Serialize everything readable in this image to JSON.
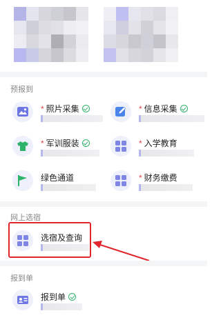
{
  "sections": {
    "pre_registration": {
      "title": "预报到",
      "items": [
        {
          "label": "照片采集",
          "required": true,
          "done": true,
          "icon": "photo-icon"
        },
        {
          "label": "信息采集",
          "required": true,
          "done": true,
          "icon": "edit-icon"
        },
        {
          "label": "军训服装",
          "required": true,
          "done": true,
          "icon": "tshirt-icon"
        },
        {
          "label": "入学教育",
          "required": true,
          "done": false,
          "icon": "grid-icon"
        },
        {
          "label": "绿色通道",
          "required": false,
          "done": false,
          "icon": "flag-icon"
        },
        {
          "label": "财务缴费",
          "required": true,
          "done": false,
          "icon": "grid-icon"
        }
      ]
    },
    "online_dorm": {
      "title": "网上选宿",
      "items": [
        {
          "label": "选宿及查询",
          "required": false,
          "done": false,
          "icon": "grid-icon"
        }
      ]
    },
    "report_form": {
      "title": "报到单",
      "items": [
        {
          "label": "报到单",
          "required": false,
          "done": true,
          "icon": "id-card-icon"
        }
      ]
    }
  },
  "colors": {
    "accent": "#7f86e6",
    "required": "#e0474c",
    "done": "#2fb36a",
    "highlight": "#e0262c"
  }
}
